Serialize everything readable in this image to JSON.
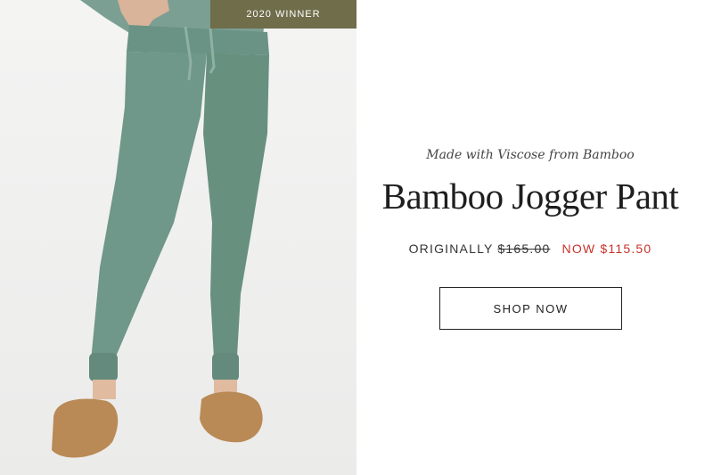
{
  "badge": {
    "text": "2020 WINNER"
  },
  "product": {
    "tagline": "Made with Viscose from Bamboo",
    "title": "Bamboo Jogger Pant",
    "price_label": "ORIGINALLY",
    "price_original": "$165.00",
    "price_now": "NOW $115.50"
  },
  "cta": {
    "label": "SHOP NOW"
  },
  "colors": {
    "badge_bg": "#6f6d4a",
    "sale_price": "#c8322c",
    "pant_green": "#6f978a",
    "slipper_tan": "#b98a55"
  }
}
